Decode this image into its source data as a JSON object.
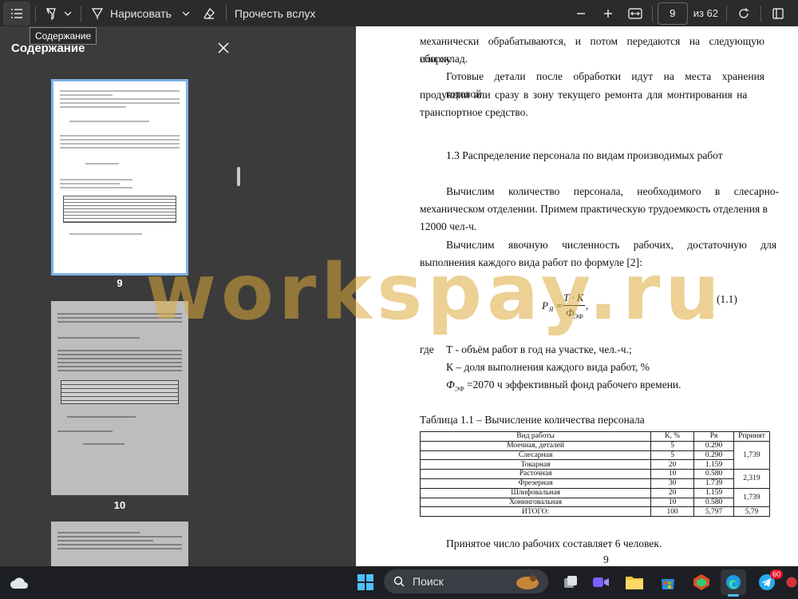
{
  "toolbar": {
    "draw_label": "Нарисовать",
    "read_aloud_label": "Прочесть вслух",
    "page_number": "9",
    "page_total": "из 62"
  },
  "sidebar": {
    "tooltip": "Содержание",
    "title": "Содержание",
    "thumbnails": [
      {
        "page_label": "9"
      },
      {
        "page_label": "10"
      }
    ]
  },
  "document": {
    "para1_line1": "механически обрабатываются, и потом передаются на следующую сборку",
    "para1_line2": "или склад.",
    "para2_line1": "Готовые детали после обработки идут на места хранения готовой",
    "para2_line2": "продукции или сразу в зону текущего ремонта для монтирования на",
    "para2_line3": "транспортное средство.",
    "section_heading": "1.3 Распределение персонала по видам производимых работ",
    "para3_line1": "Вычислим количество персонала, необходимого в слесарно-",
    "para3_line2": "механическом отделении. Примем практическую трудоемкость отделения в",
    "para3_line3": "12000 чел-ч.",
    "para4_line1": "Вычислим явочную численность рабочих, достаточную для",
    "para4_line2": "выполнения каждого вида работ по формуле [2]:",
    "formula_lhs": "P",
    "formula_lhs_sub": "Я",
    "formula_num": "T · K",
    "formula_den": "Ф",
    "formula_den_sub": "ЭФ",
    "formula_number": "(1.1)",
    "where_label": "где",
    "where_t": "T - объём работ в год на участке, чел.-ч.;",
    "where_k": "К – доля выполнения каждого вида работ, %",
    "where_f_sym": "Ф",
    "where_f_sub": "ЭФ",
    "where_f": " =2070 ч эффективный фонд рабочего времени.",
    "table_caption": "Таблица 1.1 – Вычисление количества персонала",
    "table": {
      "headers": [
        "Вид работы",
        "К, %",
        "Pя",
        "Pпринят"
      ],
      "rows": [
        [
          "Моечная, деталей",
          "5",
          "0.290"
        ],
        [
          "Слесарная",
          "5",
          "0.290"
        ],
        [
          "Токарная",
          "20",
          "1.159"
        ],
        [
          "Расточная",
          "10",
          "0.580"
        ],
        [
          "Фрезерная",
          "30",
          "1.739"
        ],
        [
          "Шлифовальная",
          "20",
          "1.159"
        ],
        [
          "Хонинговальная",
          "10",
          "0.580"
        ],
        [
          "ИТОГО:",
          "100",
          "5,797"
        ]
      ],
      "accepted": [
        "1,739",
        "2,319",
        "1,739",
        "5,79"
      ]
    },
    "conclusion": "Принятое число рабочих составляет 6 человек.",
    "page_footer": "9"
  },
  "watermark": "workspay.ru",
  "taskbar": {
    "search_placeholder": "Поиск",
    "telegram_badge": "60"
  },
  "colors": {
    "toolbar_bg": "#2b2b2b",
    "sidebar_bg": "#3b3b3b",
    "taskbar_bg": "#1d1f24",
    "thumbnail_selected_border": "#7fb2e5",
    "watermark": "#ddaa3c"
  }
}
